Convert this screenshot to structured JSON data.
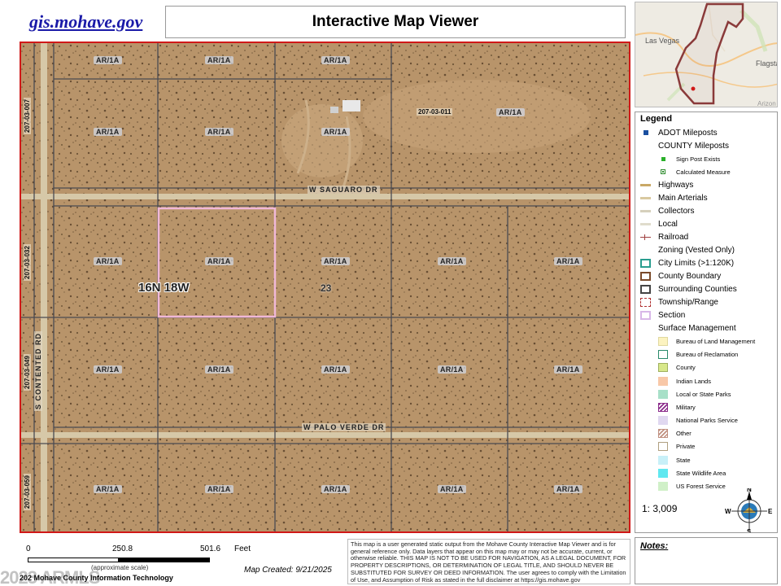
{
  "header": {
    "site_link": "gis.mohave.gov",
    "title": "Interactive Map Viewer"
  },
  "locator": {
    "labels": [
      "Las Vegas",
      "Flagsta",
      "Arizon"
    ]
  },
  "map": {
    "roads": [
      "W SAGUARO DR",
      "W PALO VERDE DR",
      "S CONTENTED RD"
    ],
    "zoning_label": "AR/1A",
    "parcel_ids": [
      "207-03-007",
      "207-03-011",
      "207-03-032",
      "207-03-049",
      "207-03-059"
    ],
    "township_range": "16N 18W",
    "section": "23"
  },
  "legend": {
    "title": "Legend",
    "items": [
      {
        "label": "ADOT Mileposts",
        "icon": "blue-square"
      },
      {
        "label": "COUNTY Mileposts",
        "icon": "none"
      },
      {
        "label": "Sign Post Exists",
        "icon": "green-square",
        "sub": true
      },
      {
        "label": "Calculated Measure",
        "icon": "green-dot-square",
        "sub": true
      },
      {
        "label": "Highways",
        "icon": "line",
        "color": "#c9a866"
      },
      {
        "label": "Main Arterials",
        "icon": "line",
        "color": "#d9c9a0"
      },
      {
        "label": "Collectors",
        "icon": "line",
        "color": "#d6d0bc"
      },
      {
        "label": "Local",
        "icon": "line",
        "color": "#e0dccc"
      },
      {
        "label": "Railroad",
        "icon": "railroad",
        "color": "#a04040"
      },
      {
        "label": "Zoning (Vested Only)",
        "icon": "none"
      },
      {
        "label": "City Limits (>1:120K)",
        "icon": "box",
        "color": "#2a9d8f"
      },
      {
        "label": "County Boundary",
        "icon": "box",
        "color": "#7a4a2a"
      },
      {
        "label": "Surrounding Counties",
        "icon": "box",
        "color": "#444444"
      },
      {
        "label": "Township/Range",
        "icon": "dashed-box",
        "color": "#b03030"
      },
      {
        "label": "Section",
        "icon": "box",
        "color": "#d8b8e8"
      },
      {
        "label": "Surface Management",
        "icon": "none"
      }
    ],
    "surface": [
      {
        "label": "Bureau of Land Management",
        "color": "#fcf3c0",
        "border": "#e0d8a0"
      },
      {
        "label": "Bureau of Reclamation",
        "color": "#ffffff",
        "border": "#2a8a6a"
      },
      {
        "label": "County",
        "color": "#d8e88a",
        "border": "#a0b060"
      },
      {
        "label": "Indian Lands",
        "color": "#f8c8a8",
        "border": "#f8c8a8"
      },
      {
        "label": "Local or State Parks",
        "color": "#a8e0c8",
        "border": "#a8e0c8"
      },
      {
        "label": "Military",
        "color": "#ffffff",
        "border": "#8a2a8a",
        "hatch": "#8a2a8a"
      },
      {
        "label": "National Parks Service",
        "color": "#e0d8f0",
        "border": "#e0d8f0"
      },
      {
        "label": "Other",
        "color": "#ffffff",
        "border": "#c09080",
        "hatch": "#c09080"
      },
      {
        "label": "Private",
        "color": "#ffffff",
        "border": "#b0a080"
      },
      {
        "label": "State",
        "color": "#c8f0f8",
        "border": "#c8f0f8"
      },
      {
        "label": "State Wildlife Area",
        "color": "#60e8f0",
        "border": "#60e8f0"
      },
      {
        "label": "US Forest Service",
        "color": "#d0f0c8",
        "border": "#d0f0c8"
      }
    ],
    "scale": "1: 3,009",
    "compass": {
      "n": "N",
      "s": "S",
      "e": "E",
      "w": "W"
    }
  },
  "footer": {
    "scale_ticks": [
      "0",
      "250.8",
      "501.6"
    ],
    "scale_unit": "Feet",
    "approx": "(approximate scale)",
    "created": "Map Created: 9/21/2025",
    "credit": "202 Mohave County Information Technology",
    "watermark": "2023 ARMLS",
    "disclaimer": "This map is a user generated static output from the Mohave County Interactive Map Viewer and is for general reference only. Data layers that appear on this map may or may not be accurate, current, or otherwise reliable. THIS MAP IS NOT TO BE USED FOR NAVIGATION, AS A LEGAL DOCUMENT, FOR PROPERTY DESCRIPTIONS, OR DETERMINATION OF LEGAL TITLE, AND SHOULD NEVER BE SUBSTITUTED FOR SURVEY OR DEED INFORMATION. The user agrees to comply with the Limitation of Use, and Assumption of Risk as stated in the full disclaimer at https://gis.mohave.gov",
    "notes": "Notes:"
  }
}
